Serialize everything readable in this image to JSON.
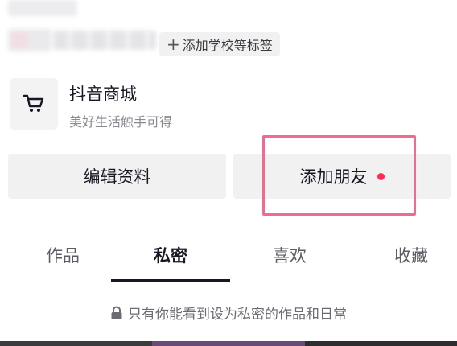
{
  "profile": {
    "add_tag_label": "添加学校等标签"
  },
  "mall": {
    "icon": "shopping-cart-icon",
    "title": "抖音商城",
    "subtitle": "美好生活触手可得"
  },
  "actions": {
    "edit_profile": "编辑资料",
    "add_friends": "添加朋友",
    "notification_color": "#fe2c55"
  },
  "tabs": [
    {
      "label": "作品"
    },
    {
      "label": "私密"
    },
    {
      "label": "喜欢"
    },
    {
      "label": "收藏"
    }
  ],
  "active_tab": "私密",
  "private_notice": {
    "icon": "lock-icon",
    "text": "只有你能看到设为私密的作品和日常"
  },
  "highlight_color": "#ef6c91"
}
